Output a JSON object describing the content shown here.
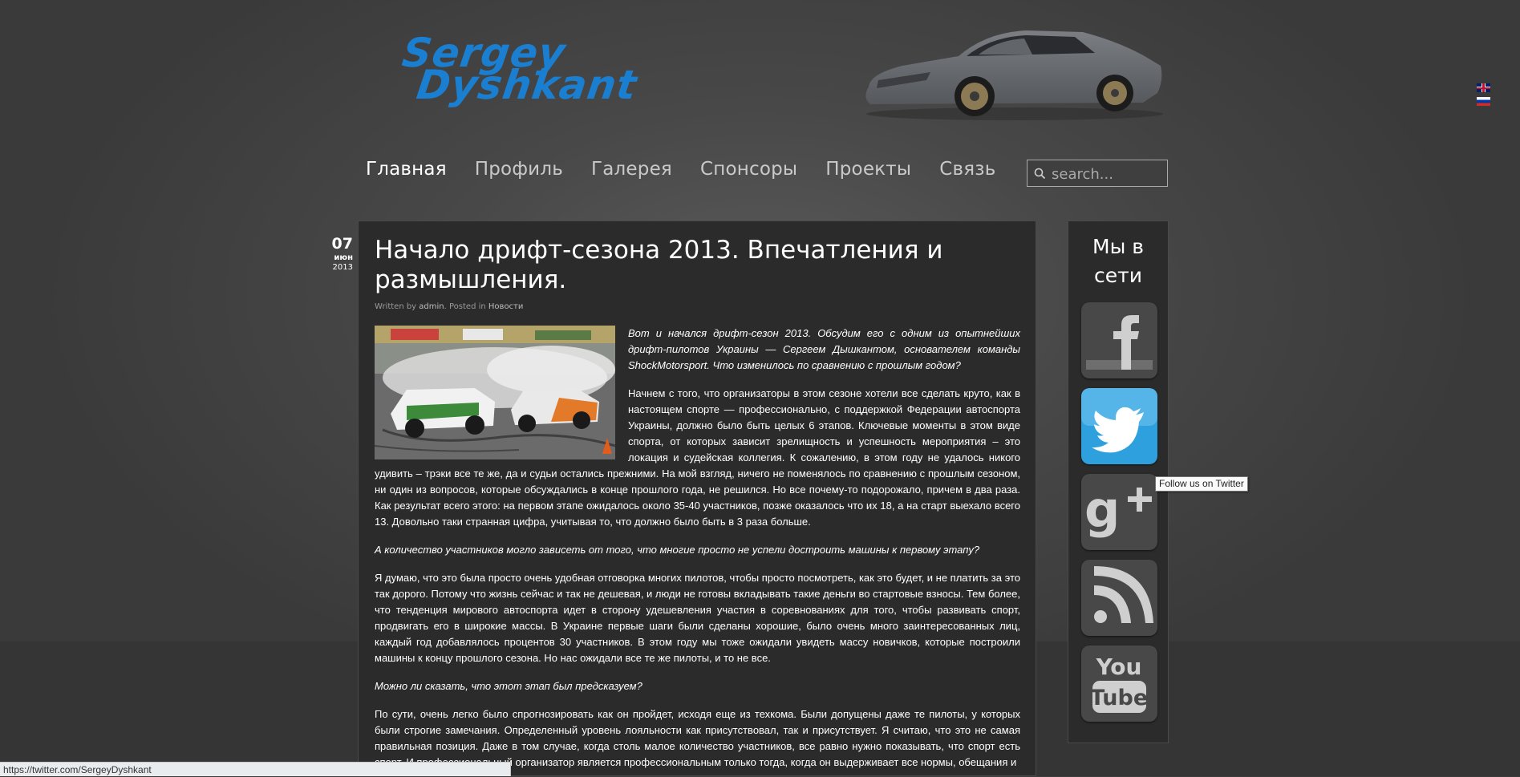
{
  "header": {
    "logo_line1": "Sergey",
    "logo_line2": "Dyshkant",
    "languages": [
      "english-flag",
      "russian-flag"
    ]
  },
  "nav": {
    "items": [
      {
        "label": "Главная",
        "active": true
      },
      {
        "label": "Профиль"
      },
      {
        "label": "Галерея"
      },
      {
        "label": "Спонсоры"
      },
      {
        "label": "Проекты"
      },
      {
        "label": "Связь"
      }
    ],
    "search_placeholder": "search..."
  },
  "post": {
    "date_day": "07",
    "date_month": "июн",
    "date_year": "2013",
    "title": "Начало дрифт-сезона 2013. Впечатления и размышления.",
    "meta_written": "Written by ",
    "meta_author": "admin",
    "meta_posted": ". Posted in ",
    "meta_category": "Новости",
    "paragraphs": [
      {
        "text": "Вот и начался дрифт-сезон 2013. Обсудим его с одним из опытнейших дрифт-пилотов Украины — Сергеем Дышкантом,  основателем команды ShockMotorsport. Что изменилось по сравнению с прошлым годом?",
        "italic": true
      },
      {
        "text": "Начнем с того,  что организаторы в этом сезоне хотели все сделать круто, как в настоящем спорте — профессионально, с поддержкой Федерации автоспорта Украины, должно было быть целых 6 этапов. Ключевые моменты в этом виде спорта, от которых зависит зрелищность и успешность мероприятия – это локация и судейская коллегия. К сожалению, в этом году не удалось никого удивить – трэки все те же, да и судьи остались прежними. На мой взгляд, ничего не поменялось по сравнению с прошлым сезоном, ни один из вопросов, которые обсуждались в конце прошлого года, не решился. Но все почему-то подорожало, причем в два раза. Как результат всего этого: на первом этапе ожидалось около 35-40 участников, позже оказалось что их 18, а на старт выехало всего 13. Довольно таки странная цифра, учитывая то, что должно было быть в 3 раза больше.",
        "italic": false
      },
      {
        "text": "А количество участников могло зависеть от того, что многие просто не успели достроить машины к первому этапу?",
        "italic": true
      },
      {
        "text": "Я думаю, что это была просто очень удобная отговорка многих пилотов, чтобы просто посмотреть, как это будет, и не платить за это так дорого. Потому что жизнь сейчас и так не дешевая, и люди не готовы вкладывать такие деньги во стартовые взносы. Тем более, что тенденция мирового автоспорта идет в сторону удешевления участия в соревнованиях для того, чтобы развивать спорт, продвигать его в широкие массы. В Украине первые шаги были сделаны хорошие, было очень много заинтересованных лиц, каждый год добавлялось процентов 30 участников. В этом году мы тоже ожидали увидеть массу новичков, которые построили машины к концу прошлого сезона. Но нас ожидали все те же пилоты, и то не все.",
        "italic": false
      },
      {
        "text": "Можно ли сказать, что этот этап был предсказуем?",
        "italic": true
      },
      {
        "text": "По сути, очень легко было спрогнозировать как он пройдет, исходя еще из техкома. Были допущены даже те пилоты, у которых были строгие замечания. Определенный уровень лояльности как присутствовал, так и присутствует. Я считаю, что это не самая правильная позиция. Даже в том случае, когда столь малое количество участников, все равно нужно показывать, что спорт есть спорт. И профессиональный организатор является профессиональным только тогда, когда он выдерживает все нормы, обещания и",
        "italic": false
      }
    ]
  },
  "sidebar": {
    "title": "Мы в сети",
    "social": [
      "facebook-icon",
      "twitter-icon",
      "google-plus-icon",
      "rss-icon",
      "youtube-icon"
    ]
  },
  "tooltip": "Follow us on Twitter",
  "status_url": "https://twitter.com/SergeyDyshkant",
  "colors": {
    "logo": "#1a7fd0",
    "twitter": "#2fa0de",
    "background": "#484848"
  }
}
